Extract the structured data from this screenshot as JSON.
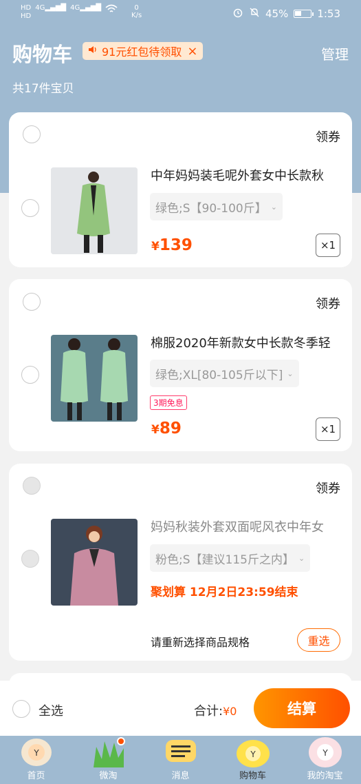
{
  "status": {
    "net_speed_value": "0",
    "net_speed_unit": "K/s",
    "sig1": "HD",
    "sig2": "4G",
    "battery": "45%",
    "battery_level": 0.45,
    "time": "1:53"
  },
  "header": {
    "title": "购物车",
    "promo": "91元红包待领取",
    "manage": "管理",
    "item_count": "共17件宝贝"
  },
  "items": [
    {
      "coupon": "领券",
      "name": "中年妈妈装毛呢外套女中长款秋",
      "sku": "绿色;S【90-100斤】",
      "currency": "¥",
      "price": "139",
      "qty": "×1"
    },
    {
      "coupon": "领券",
      "name": "棉服2020年新款女中长款冬季轻",
      "sku": "绿色;XL[80-105斤以下]",
      "badge": "3期免息",
      "currency": "¥",
      "price": "89",
      "qty": "×1"
    },
    {
      "coupon": "领券",
      "name": "妈妈秋装外套双面呢风衣中年女",
      "sku": "粉色;S【建议115斤之内】",
      "deal": "聚划算 12月2日23:59结束",
      "reselect_text": "请重新选择商品规格",
      "reselect_btn": "重选"
    }
  ],
  "checkout": {
    "select_all": "全选",
    "total_label": "合计:",
    "total_amount": "¥0",
    "button": "结算"
  },
  "tabs": [
    {
      "label": "首页",
      "icon": "home-icon"
    },
    {
      "label": "微淘",
      "icon": "weitao-icon"
    },
    {
      "label": "消息",
      "icon": "message-icon"
    },
    {
      "label": "购物车",
      "icon": "cart-icon"
    },
    {
      "label": "我的淘宝",
      "icon": "profile-icon"
    }
  ],
  "colors": {
    "accent": "#ff5000",
    "header_bg": "#9fbad1"
  }
}
